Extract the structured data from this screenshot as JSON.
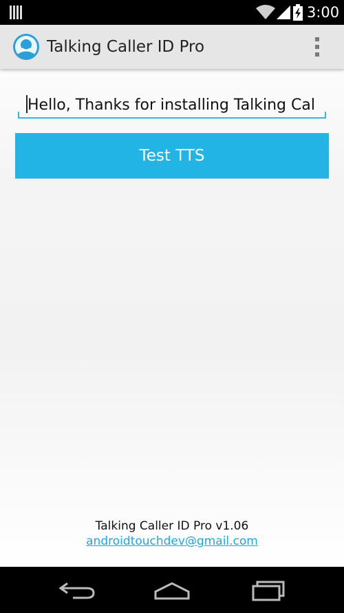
{
  "status_bar": {
    "time": "3:00",
    "icons": [
      "notification-icon",
      "wifi-icon",
      "signal-icon",
      "battery-charging-icon"
    ]
  },
  "action_bar": {
    "title": "Talking Caller ID Pro",
    "app_icon": "avatar-icon",
    "overflow_icon": "overflow-menu-icon"
  },
  "main": {
    "tts_input": {
      "value": "Hello, Thanks for installing Talking Cal",
      "placeholder": ""
    },
    "test_button_label": "Test TTS"
  },
  "footer": {
    "version": "Talking Caller ID Pro v1.06",
    "email": "androidtouchdev@gmail.com"
  },
  "nav_bar": {
    "icons": [
      "back-icon",
      "home-icon",
      "recents-icon"
    ]
  },
  "colors": {
    "accent": "#33b5e5",
    "button": "#23b4e6",
    "link": "#1ea7dd",
    "action_bar": "#e6e6e6"
  }
}
